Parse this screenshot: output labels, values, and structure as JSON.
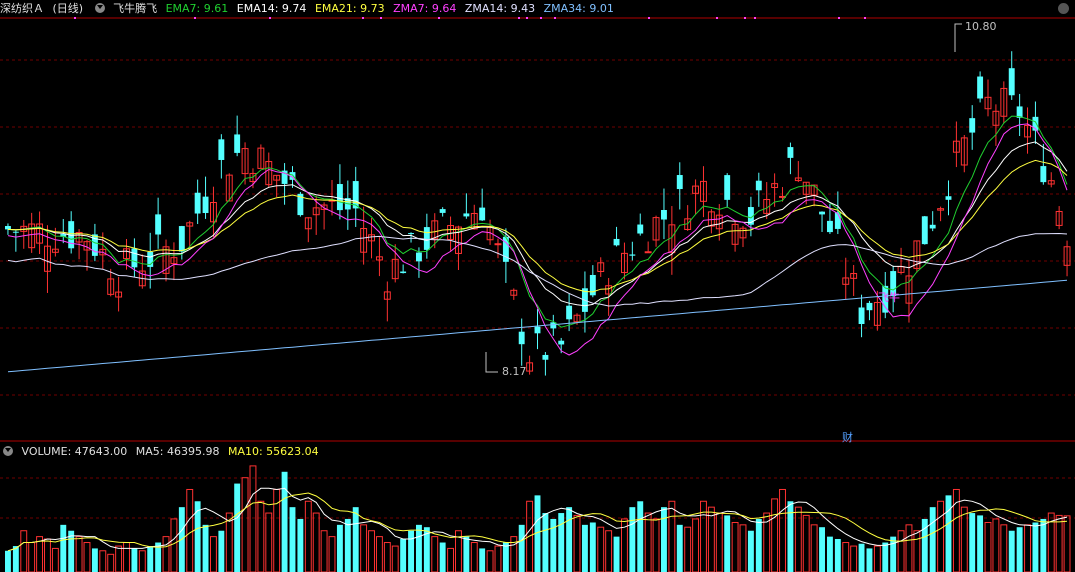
{
  "main_header": {
    "stock": "深纺织Ａ",
    "period": "(日线)",
    "indicator": "飞牛腾飞",
    "ema7": "EMA7: 9.61",
    "ema14": "EMA14: 9.74",
    "ema21": "EMA21: 9.73",
    "zma7": "ZMA7: 9.64",
    "zma14": "ZMA14: 9.43",
    "zma34": "ZMA34: 9.01"
  },
  "volume_header": {
    "volume": "VOLUME: 47643.00",
    "ma5": "MA5: 46395.98",
    "ma10": "MA10: 55623.04"
  },
  "annotations": {
    "high": "10.80",
    "low": "8.17",
    "signal": "飞牛",
    "finance_marker": "财"
  },
  "colors": {
    "up": "#ff3232",
    "down": "#54ffff",
    "ema7": "#20d030",
    "ema14": "#ffffff",
    "ema21": "#ffff40",
    "zma7": "#ff40ff",
    "zma14": "#e0e0ff",
    "zma34": "#80c0ff",
    "grid": "#700000",
    "border": "#b00000"
  },
  "chart_data": {
    "type": "candlestick",
    "price_ylim": [
      7.7,
      11.1
    ],
    "volume_ylim": [
      0,
      95000
    ],
    "high_mark": 10.8,
    "low_mark": 8.17,
    "close_first": 9.4,
    "close_last": 9.38,
    "vol_hint": [
      18000,
      22000,
      35000,
      25000,
      30000,
      28000,
      20000,
      40000,
      35000,
      30000,
      25000,
      20000,
      18000,
      15000,
      22000,
      25000,
      20000,
      18000,
      22000,
      25000,
      30000,
      45000,
      55000,
      70000,
      60000,
      40000,
      30000,
      35000,
      50000,
      75000,
      80000,
      90000,
      60000,
      50000,
      70000,
      85000,
      55000,
      45000,
      60000,
      50000,
      35000,
      30000,
      40000,
      45000,
      55000,
      40000,
      35000,
      30000,
      25000,
      22000,
      28000,
      35000,
      40000,
      38000,
      30000,
      25000,
      20000,
      35000,
      30000,
      25000,
      20000,
      18000,
      22000,
      25000,
      30000,
      40000,
      60000,
      65000,
      50000,
      45000,
      50000,
      55000,
      48000,
      40000,
      42000,
      38000,
      35000,
      30000,
      45000,
      55000,
      60000,
      50000,
      45000,
      55000,
      60000,
      40000,
      38000,
      45000,
      60000,
      55000,
      50000,
      48000,
      42000,
      40000,
      35000,
      45000,
      50000,
      62000,
      70000,
      60000,
      55000,
      48000,
      40000,
      38000,
      30000,
      28000,
      25000,
      22000,
      24000,
      20000,
      22000,
      25000,
      30000,
      35000,
      40000,
      35000,
      45000,
      55000,
      60000,
      65000,
      70000,
      55000,
      50000,
      48000,
      42000,
      45000,
      40000,
      35000,
      38000,
      40000,
      42000,
      45000,
      50000,
      48000,
      47643
    ]
  }
}
